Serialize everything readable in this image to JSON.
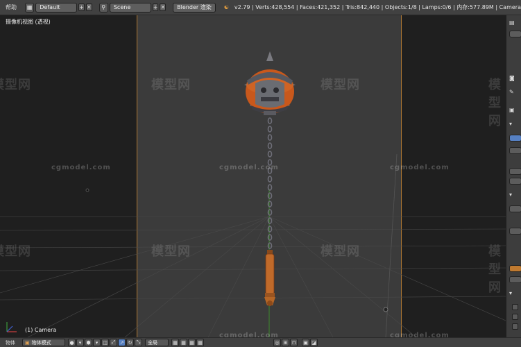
{
  "header": {
    "menu_help": "帮助",
    "layout_name": "Default",
    "scene_name": "Scene",
    "render_engine": "Blender 渲染",
    "stats": "v2.79 | Verts:428,554 | Faces:421,352 | Tris:842,440 | Objects:1/8 | Lamps:0/6 | 内存:577.89M | Camera"
  },
  "viewport": {
    "view_title": "摄像机视图 (透视)",
    "active_object": "(1) Camera",
    "watermark_text": "模型网",
    "watermark_url": "cgmodel.com"
  },
  "footer": {
    "view_menu": "物体",
    "mode": "物体模式",
    "pivot": "全局"
  },
  "colors": {
    "camera_frame": "#b47b33",
    "accent_blue": "#5680c2",
    "mace_orange": "#c8581c"
  }
}
